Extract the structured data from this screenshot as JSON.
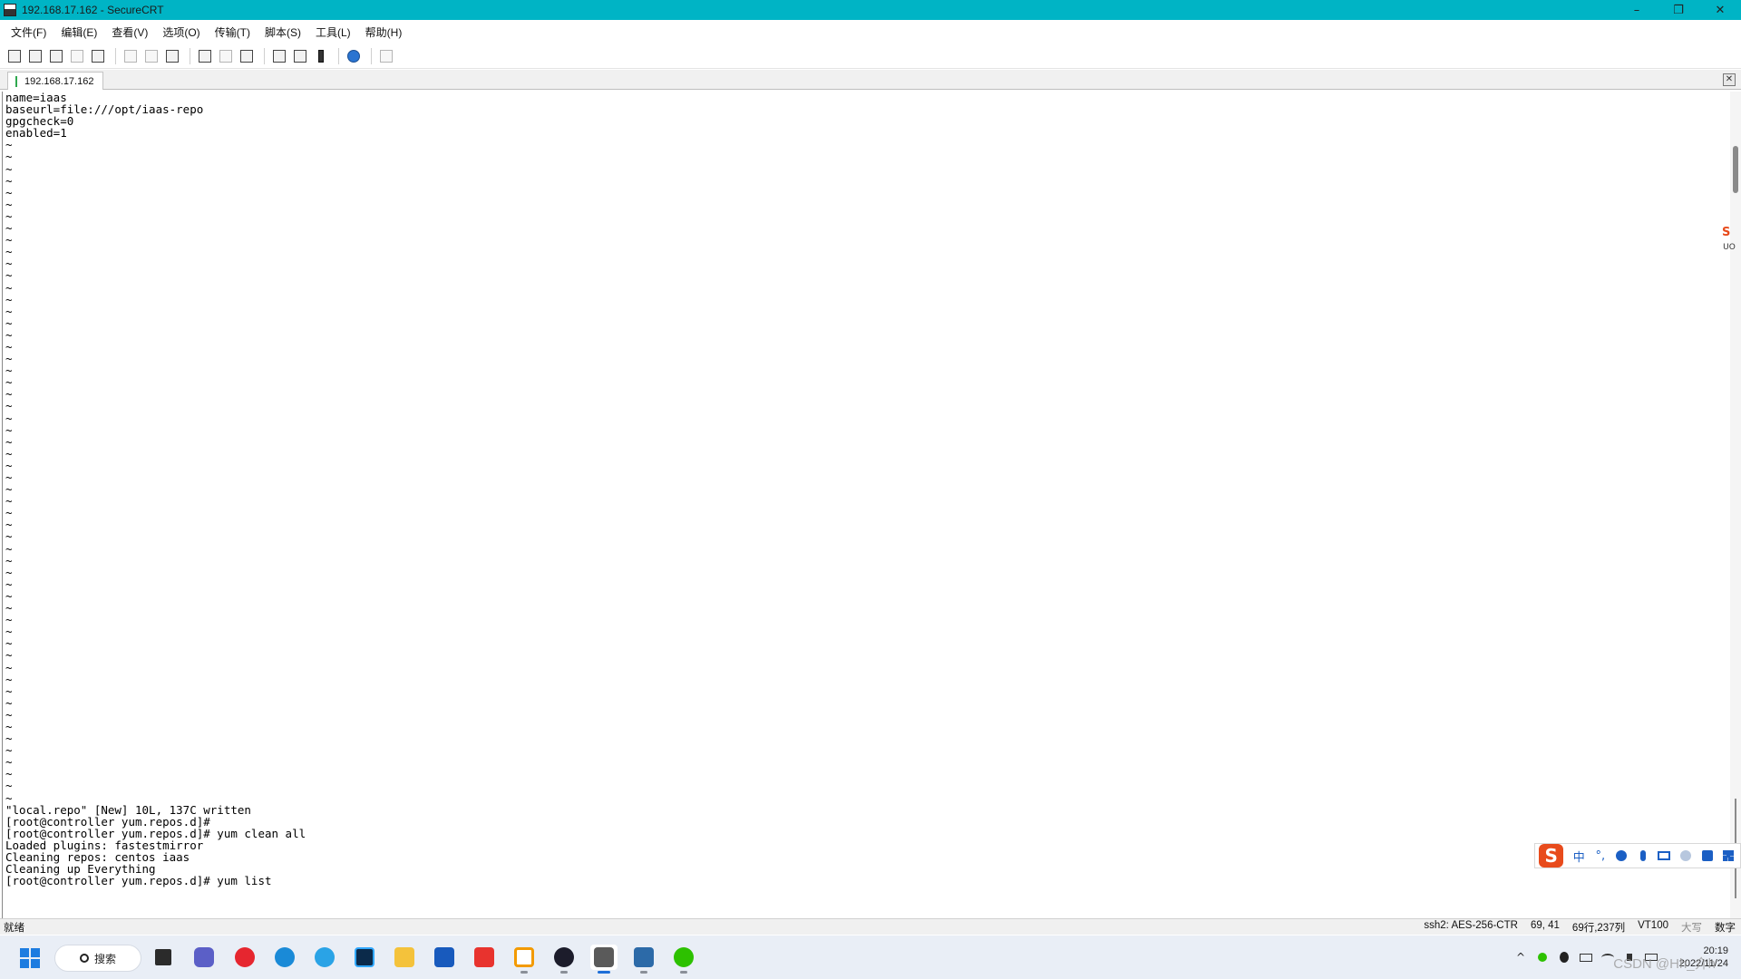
{
  "window": {
    "title": "192.168.17.162 - SecureCRT",
    "minimize_glyph": "–",
    "maximize_glyph": "❐",
    "close_glyph": "✕"
  },
  "menubar": {
    "items": [
      {
        "label": "文件(F)"
      },
      {
        "label": "编辑(E)"
      },
      {
        "label": "查看(V)"
      },
      {
        "label": "选项(O)"
      },
      {
        "label": "传输(T)"
      },
      {
        "label": "脚本(S)"
      },
      {
        "label": "工具(L)"
      },
      {
        "label": "帮助(H)"
      }
    ]
  },
  "toolbar": {
    "icons": [
      "connect-icon",
      "quick-connect-icon",
      "connect-in-tab-icon",
      "reconnect-icon",
      "disconnect-icon",
      "copy-icon",
      "paste-icon",
      "find-icon",
      "print-icon",
      "print-selection-icon",
      "printer-icon",
      "session-options-icon",
      "global-options-icon",
      "keymap-icon",
      "help-icon",
      "sftp-icon"
    ]
  },
  "tab": {
    "label": "192.168.17.162",
    "close_glyph": "✕"
  },
  "terminal": {
    "lines": [
      "name=iaas",
      "baseurl=file:///opt/iaas-repo",
      "gpgcheck=0",
      "enabled=1",
      "~",
      "~",
      "~",
      "~",
      "~",
      "~",
      "~",
      "~",
      "~",
      "~",
      "~",
      "~",
      "~",
      "~",
      "~",
      "~",
      "~",
      "~",
      "~",
      "~",
      "~",
      "~",
      "~",
      "~",
      "~",
      "~",
      "~",
      "~",
      "~",
      "~",
      "~",
      "~",
      "~",
      "~",
      "~",
      "~",
      "~",
      "~",
      "~",
      "~",
      "~",
      "~",
      "~",
      "~",
      "~",
      "~",
      "~",
      "~",
      "~",
      "~",
      "~",
      "~",
      "~",
      "~",
      "~",
      "~",
      "\"local.repo\" [New] 10L, 137C written",
      "[root@controller yum.repos.d]#",
      "[root@controller yum.repos.d]# yum clean all",
      "Loaded plugins: fastestmirror",
      "Cleaning repos: centos iaas",
      "Cleaning up Everything",
      "[root@controller yum.repos.d]# yum list"
    ]
  },
  "ime": {
    "side_logo": "S",
    "side_label": "UO",
    "bar_logo": "S",
    "mode": "中",
    "punct": "°,",
    "items": [
      "emoji-icon",
      "microphone-icon",
      "keyboard-icon",
      "user-icon",
      "skin-icon",
      "toolbox-icon"
    ]
  },
  "statusbar": {
    "ready": "就绪",
    "protocol": "ssh2: AES-256-CTR",
    "cursor": "69,  41",
    "size": "69行,237列",
    "emulation": "VT100",
    "caps": "大写",
    "numlock": "数字"
  },
  "taskbar": {
    "search_label": "搜索",
    "apps": [
      "start-icon",
      "file-explorer-task-icon",
      "meet-icon",
      "netease-music-icon",
      "edge-icon",
      "ie-icon",
      "photoshop-icon",
      "folder-icon",
      "word-icon",
      "wps-icon",
      "vmware-icon",
      "obs-icon",
      "securecrt-icon",
      "securefx-icon",
      "wechat-icon"
    ],
    "tray": {
      "chevron": "^",
      "time": "20:19",
      "date": "2022/11/24"
    },
    "watermark": "CSDN @Hh_介h"
  },
  "colors": {
    "titlebar": "#00b4c5",
    "accent": "#1d6ed8",
    "ime_orange": "#e84b1c"
  }
}
